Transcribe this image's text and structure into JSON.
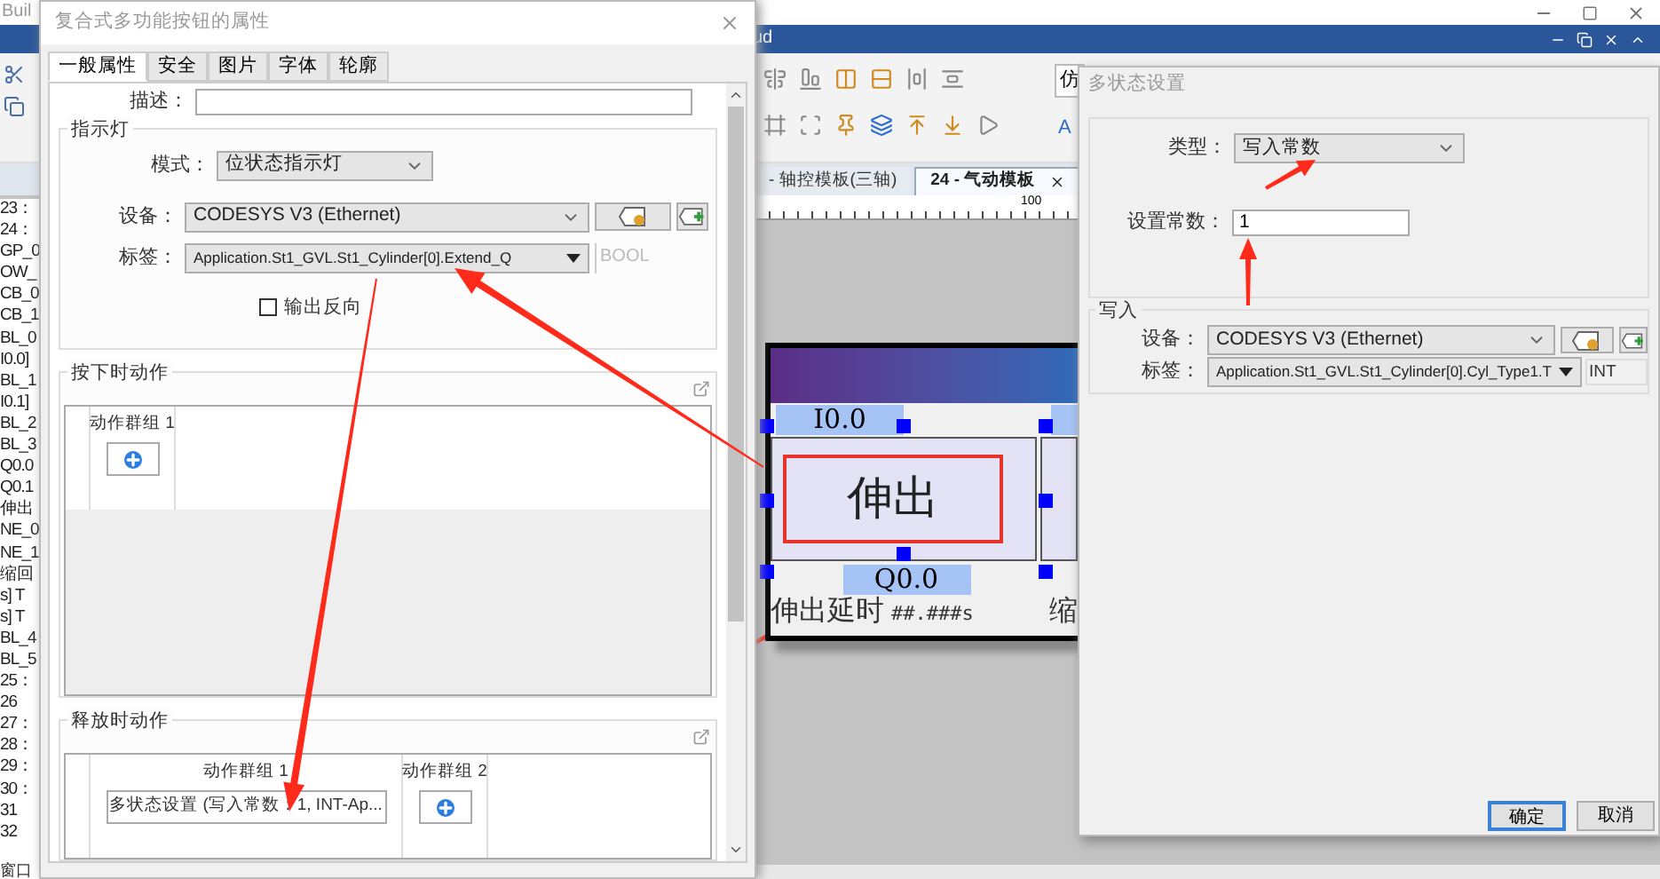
{
  "background_app": {
    "title_fragment": "Buil",
    "title_bar_fragment": "ud",
    "toolbar_fragments": [
      "仿",
      "A"
    ],
    "document_tabs": [
      {
        "label": "- 轴控模板(三轴)",
        "selected": false
      },
      {
        "label": "24 - 气动模板",
        "selected": true
      }
    ],
    "ruler_label": "100",
    "side_list": [
      "23：",
      "24：",
      "GP_0",
      "OW_",
      "CB_0",
      "CB_1",
      "BL_0",
      "I0.0]",
      "BL_1",
      "I0.1]",
      "BL_2",
      "BL_3",
      "Q0.0",
      "Q0.1",
      "伸出",
      "NE_0",
      "NE_1",
      "缩回",
      "s] T",
      "s] T",
      "BL_4",
      "BL_5",
      "25：",
      "26",
      "27：",
      "28：",
      "29：",
      "30：",
      "31",
      "32"
    ],
    "bottom_fragment": "窗口",
    "canvas_widget": {
      "input_label": "I0.0",
      "button_label": "伸出",
      "output_label": "Q0.0",
      "delay_label": "伸出延时",
      "delay_format": "##.###s",
      "next_label_fragment": "缩"
    }
  },
  "properties_dialog": {
    "title": "复合式多功能按钮的属性",
    "tabs": [
      {
        "label": "一般属性",
        "selected": true
      },
      {
        "label": "安全",
        "selected": false
      },
      {
        "label": "图片",
        "selected": false
      },
      {
        "label": "字体",
        "selected": false
      },
      {
        "label": "轮廓",
        "selected": false
      }
    ],
    "description": {
      "label": "描述："
    },
    "indicator": {
      "title": "指示灯",
      "mode": {
        "label": "模式：",
        "value": "位状态指示灯"
      },
      "device": {
        "label": "设备：",
        "value": "CODESYS V3 (Ethernet)"
      },
      "tag": {
        "label": "标签：",
        "value": "Application.St1_GVL.St1_Cylinder[0].Extend_Q",
        "type": "BOOL"
      },
      "invert_output": {
        "label": "输出反向",
        "checked": false
      }
    },
    "press_actions": {
      "title": "按下时动作",
      "columns": [
        "动作群组 1"
      ]
    },
    "release_actions": {
      "title": "释放时动作",
      "columns": [
        "动作群组 1",
        "动作群组 2"
      ],
      "actions": [
        "多状态设置 (写入常数：1, INT-Ap..."
      ]
    }
  },
  "multistate_dialog": {
    "title": "多状态设置",
    "type": {
      "label": "类型：",
      "value": "写入常数"
    },
    "constant": {
      "label": "设置常数：",
      "value": "1"
    },
    "write": {
      "title": "写入",
      "device": {
        "label": "设备：",
        "value": "CODESYS V3 (Ethernet)"
      },
      "tag": {
        "label": "标签：",
        "value": "Application.St1_GVL.St1_Cylinder[0].Cyl_Type1.T",
        "type": "INT"
      }
    },
    "buttons": [
      {
        "label": "确定",
        "default": true
      },
      {
        "label": "取消",
        "default": false
      }
    ]
  }
}
